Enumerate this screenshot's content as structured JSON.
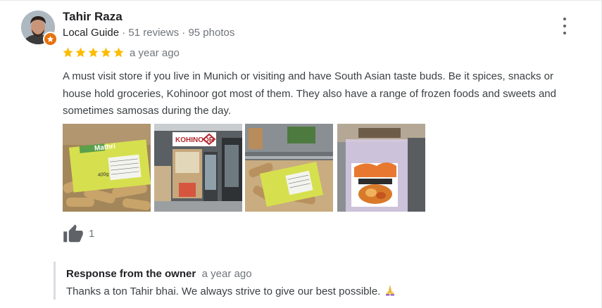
{
  "reviewer": {
    "name": "Tahir Raza",
    "badge": "Local Guide",
    "separator": "·",
    "reviews": "51 reviews",
    "photos": "95 photos"
  },
  "review": {
    "rating": 5,
    "max_rating": 5,
    "date": "a year ago",
    "text": "A must visit store if you live in Munich or visiting and have South Asian taste buds. Be it spices, snacks or house hold groceries, Kohinoor got most of them. They also have a range of frozen foods and sweets and sometimes samosas during the day."
  },
  "photos": [
    {
      "icon": "snack-package-photo",
      "label_brand": "Mathri",
      "label_weight": "400g"
    },
    {
      "icon": "storefront-photo",
      "sign": "KOHINOOR"
    },
    {
      "icon": "snack-tray-photo"
    },
    {
      "icon": "frozen-food-package-photo"
    }
  ],
  "likes": {
    "count": "1"
  },
  "owner_response": {
    "title": "Response from the owner",
    "date": "a year ago",
    "text": "Thanks a ton Tahir bhai. We always strive to give our best possible."
  },
  "colors": {
    "star": "#fbbc04",
    "local_guide_badge": "#e8710a",
    "secondary_text": "#70757a"
  }
}
